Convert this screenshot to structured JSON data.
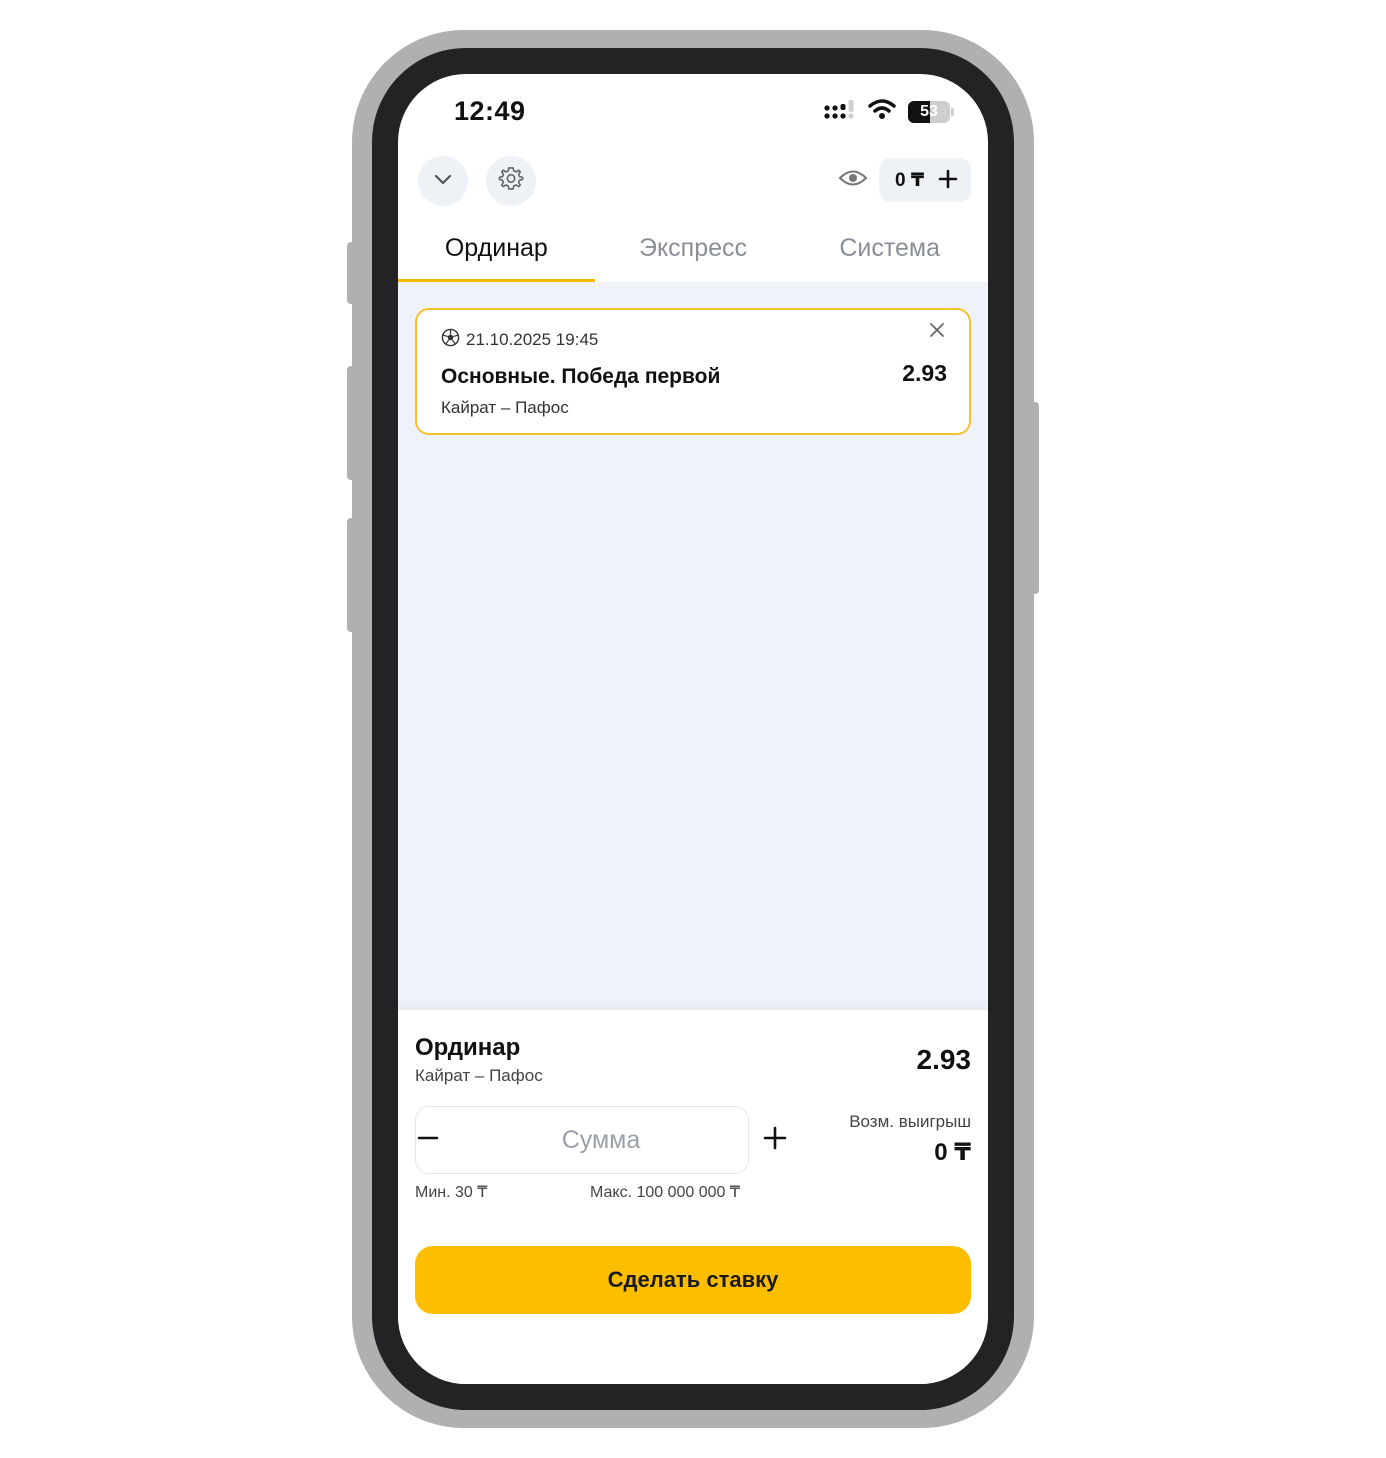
{
  "status_bar": {
    "time": "12:49",
    "battery": "53",
    "icons": [
      "signal-icon",
      "wifi-icon",
      "battery-icon"
    ]
  },
  "header": {
    "icons": [
      "chevron-down-icon",
      "gear-icon",
      "eye-icon",
      "plus-icon"
    ],
    "balance": "0 ₸"
  },
  "tabs": [
    {
      "label": "Ординар",
      "active": true
    },
    {
      "label": "Экспресс",
      "active": false
    },
    {
      "label": "Система",
      "active": false
    }
  ],
  "bet": {
    "sport_icon": "football-icon",
    "datetime": "21.10.2025 19:45",
    "market": "Основные. Победа первой",
    "teams": "Кайрат – Пафос",
    "odd": "2.93"
  },
  "slip": {
    "type": "Ординар",
    "teams": "Кайрат – Пафос",
    "odd": "2.93",
    "amount_placeholder": "Сумма",
    "amount_value": "",
    "min": "Мин. 30 ₸",
    "max": "Макс. 100 000 000 ₸",
    "win_label": "Возм. выигрыш",
    "win_value": "0 ₸",
    "submit": "Сделать ставку"
  },
  "colors": {
    "accent": "#fdbe00",
    "card_border": "#f5c12e",
    "background": "#eff3f9"
  }
}
